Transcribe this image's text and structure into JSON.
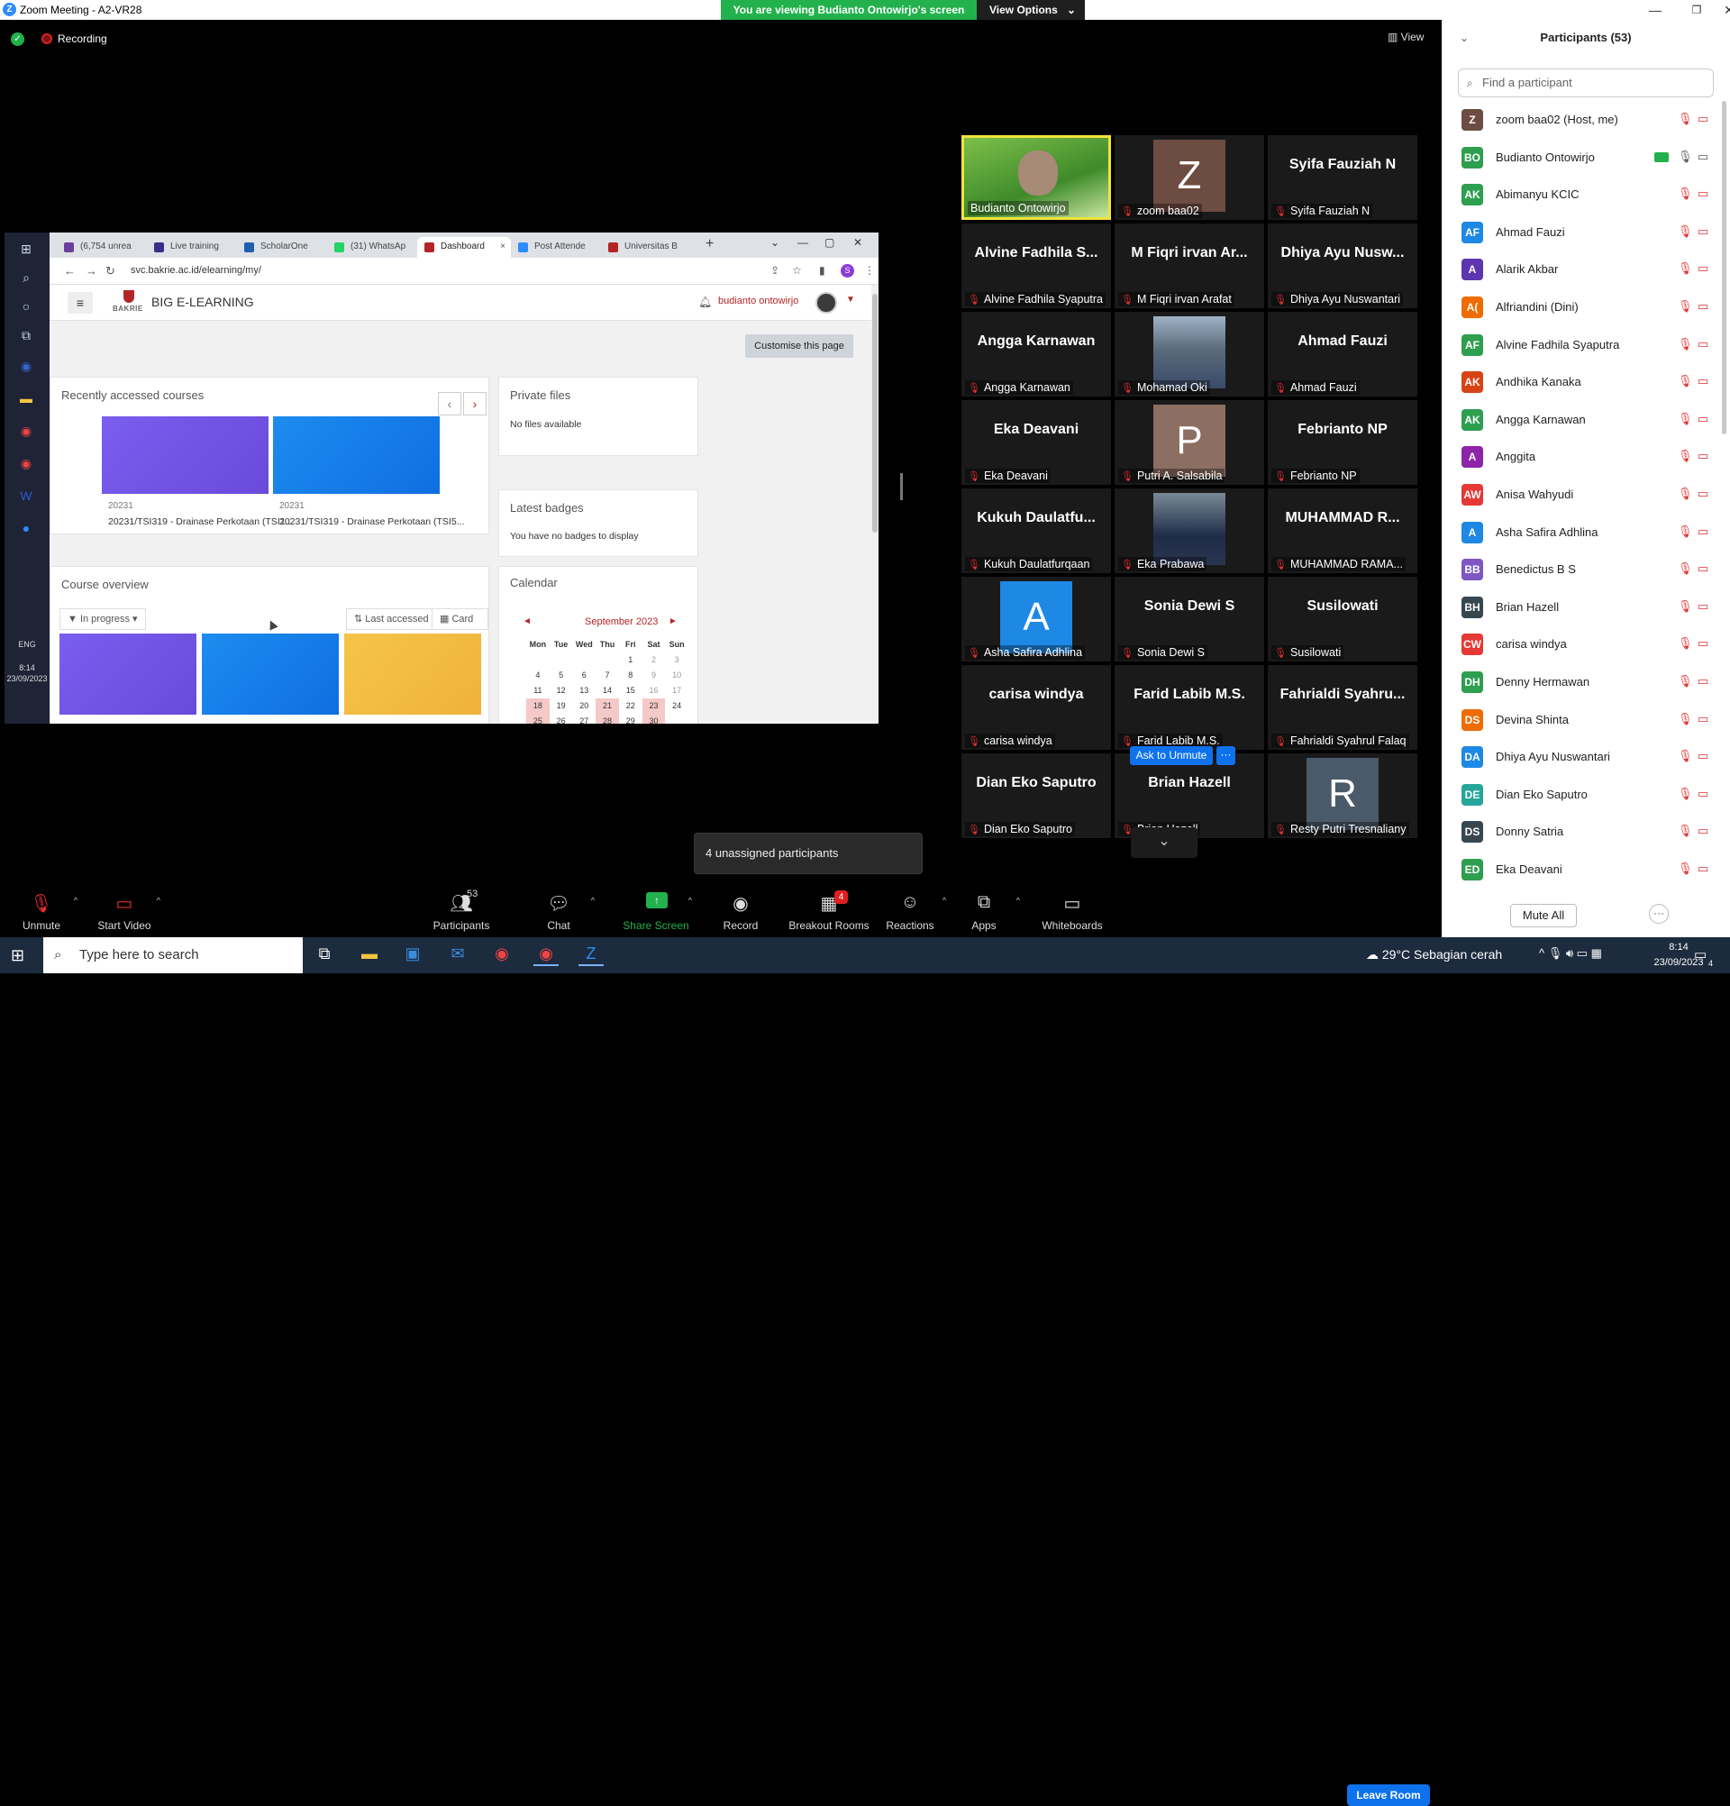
{
  "window": {
    "title": "Zoom Meeting - A2-VR28",
    "viewing_banner": "You are viewing Budianto Ontowirjo's screen",
    "view_options": "View Options",
    "recording": "Recording",
    "view": "View"
  },
  "shared": {
    "tabs": [
      "(6,754 unrea",
      "Live training",
      "ScholarOne",
      "(31) WhatsAp",
      "Dashboard",
      "Post Attende",
      "Universitas B"
    ],
    "url": "svc.bakrie.ac.id/elearning/my/",
    "profile_initial": "S",
    "logo_text": "BAKRIE",
    "site_name": "BIG E-LEARNING",
    "user_name": "budianto ontowirjo",
    "customise": "Customise this page",
    "recent_title": "Recently accessed courses",
    "courses": [
      {
        "year": "20231",
        "name": "20231/TSI319 - Drainase Perkotaan (TSI1..."
      },
      {
        "year": "20231",
        "name": "20231/TSI319 - Drainase Perkotaan (TSI5..."
      }
    ],
    "private_title": "Private files",
    "private_body": "No files available",
    "badges_title": "Latest badges",
    "badges_body": "You have no badges to display",
    "overview_title": "Course overview",
    "filter_label": "In progress",
    "sort_label": "Last accessed",
    "view_label": "Card",
    "calendar_title": "Calendar",
    "calendar_month": "September 2023",
    "calendar_days": [
      "Mon",
      "Tue",
      "Wed",
      "Thu",
      "Fri",
      "Sat",
      "Sun"
    ],
    "calendar_rows": [
      [
        "",
        "",
        "",
        "",
        "1",
        "2",
        "3"
      ],
      [
        "4",
        "5",
        "6",
        "7",
        "8",
        "9",
        "10"
      ],
      [
        "11",
        "12",
        "13",
        "14",
        "15",
        "16",
        "17"
      ],
      [
        "18",
        "19",
        "20",
        "21",
        "22",
        "23",
        "24"
      ],
      [
        "25",
        "26",
        "27",
        "28",
        "29",
        "30",
        ""
      ]
    ],
    "clock_time": "8:14",
    "clock_date": "23/09/2023",
    "lang": "ENG"
  },
  "gallery": {
    "tiles": [
      {
        "big": "",
        "label": "Budianto Ontowirjo",
        "muted": false,
        "type": "photo",
        "active": true
      },
      {
        "big": "Z",
        "label": "zoom baa02",
        "muted": true,
        "type": "avatar",
        "color": "#6d4c41"
      },
      {
        "big": "Syifa Fauziah N",
        "label": "Syifa Fauziah N",
        "muted": true,
        "type": "name"
      },
      {
        "big": "Alvine Fadhila S...",
        "label": "Alvine Fadhila Syaputra",
        "muted": true,
        "type": "name"
      },
      {
        "big": "M Fiqri irvan Ar...",
        "label": "M Fiqri irvan Arafat",
        "muted": true,
        "type": "name"
      },
      {
        "big": "Dhiya Ayu Nusw...",
        "label": "Dhiya Ayu Nuswantari",
        "muted": true,
        "type": "name"
      },
      {
        "big": "Angga Karnawan",
        "label": "Angga Karnawan",
        "muted": true,
        "type": "name"
      },
      {
        "big": "",
        "label": "Mohamad Oki",
        "muted": true,
        "type": "photo2"
      },
      {
        "big": "Ahmad Fauzi",
        "label": "Ahmad Fauzi",
        "muted": true,
        "type": "name"
      },
      {
        "big": "Eka Deavani",
        "label": "Eka Deavani",
        "muted": true,
        "type": "name"
      },
      {
        "big": "P",
        "label": "Putri A. Salsabila",
        "muted": true,
        "type": "avatar",
        "color": "#8d6e63"
      },
      {
        "big": "Febrianto NP",
        "label": "Febrianto NP",
        "muted": true,
        "type": "name"
      },
      {
        "big": "Kukuh  Daulatfu...",
        "label": "Kukuh Daulatfurqaan",
        "muted": true,
        "type": "name"
      },
      {
        "big": "",
        "label": "Eka Prabawa",
        "muted": true,
        "type": "photo3"
      },
      {
        "big": "MUHAMMAD  R...",
        "label": "MUHAMMAD RAMA...",
        "muted": true,
        "type": "name"
      },
      {
        "big": "A",
        "label": "Asha Safira Adhlina",
        "muted": true,
        "type": "avatar",
        "color": "#1e88e5"
      },
      {
        "big": "Sonia Dewi S",
        "label": "Sonia Dewi S",
        "muted": true,
        "type": "name"
      },
      {
        "big": "Susilowati",
        "label": "Susilowati",
        "muted": true,
        "type": "name"
      },
      {
        "big": "carisa windya",
        "label": "carisa windya",
        "muted": true,
        "type": "name"
      },
      {
        "big": "Farid Labib M.S.",
        "label": "Farid Labib M.S.",
        "muted": true,
        "type": "name"
      },
      {
        "big": "Fahrialdi  Syahru...",
        "label": "Fahrialdi Syahrul Falaq",
        "muted": true,
        "type": "name"
      },
      {
        "big": "Dian Eko Saputro",
        "label": "Dian Eko Saputro",
        "muted": true,
        "type": "name"
      },
      {
        "big": "Brian Hazell",
        "label": "Brian Hazell",
        "muted": true,
        "type": "name"
      },
      {
        "big": "R",
        "label": "Resty Putri Tresnaliany",
        "muted": true,
        "type": "avatar",
        "color": "#4a5a6a"
      }
    ],
    "ask_unmute": "Ask to Unmute",
    "more": "···",
    "unassigned": "4 unassigned participants"
  },
  "participants": {
    "header": "Participants (53)",
    "search_placeholder": "Find a participant",
    "rows": [
      {
        "initials": "Z",
        "name": "zoom baa02 (Host, me)",
        "color": "#6d4c41"
      },
      {
        "initials": "BO",
        "name": "Budianto Ontowirjo",
        "color": "#2e9e4f",
        "sharing": true
      },
      {
        "initials": "AK",
        "name": "Abimanyu KCIC",
        "color": "#2e9e4f"
      },
      {
        "initials": "AF",
        "name": "Ahmad Fauzi",
        "color": "#1e88e5"
      },
      {
        "initials": "A",
        "name": "Alarik Akbar",
        "color": "#5e35b1"
      },
      {
        "initials": "A(",
        "name": "Alfriandini (Dini)",
        "color": "#ef6c00"
      },
      {
        "initials": "AF",
        "name": "Alvine Fadhila Syaputra",
        "color": "#2e9e4f"
      },
      {
        "initials": "AK",
        "name": "Andhika Kanaka",
        "color": "#d84315"
      },
      {
        "initials": "AK",
        "name": "Angga Karnawan",
        "color": "#2e9e4f"
      },
      {
        "initials": "A",
        "name": "Anggita",
        "color": "#8e24aa"
      },
      {
        "initials": "AW",
        "name": "Anisa Wahyudi",
        "color": "#e53935"
      },
      {
        "initials": "A",
        "name": "Asha Safira Adhlina",
        "color": "#1e88e5"
      },
      {
        "initials": "BB",
        "name": "Benedictus B S",
        "color": "#7e57c2"
      },
      {
        "initials": "BH",
        "name": "Brian Hazell",
        "color": "#37474f"
      },
      {
        "initials": "CW",
        "name": "carisa windya",
        "color": "#e53935"
      },
      {
        "initials": "DH",
        "name": "Denny Hermawan",
        "color": "#2e9e4f"
      },
      {
        "initials": "DS",
        "name": "Devina Shinta",
        "color": "#ef6c00"
      },
      {
        "initials": "DA",
        "name": "Dhiya Ayu Nuswantari",
        "color": "#1e88e5"
      },
      {
        "initials": "DE",
        "name": "Dian Eko Saputro",
        "color": "#26a69a"
      },
      {
        "initials": "DS",
        "name": "Donny Satria",
        "color": "#37474f"
      },
      {
        "initials": "ED",
        "name": "Eka Deavani",
        "color": "#2e9e4f"
      }
    ],
    "mute_all": "Mute All",
    "more": "···"
  },
  "toolbar": {
    "unmute": "Unmute",
    "start_video": "Start Video",
    "participants": "Participants",
    "participants_count": "53",
    "chat": "Chat",
    "share_screen": "Share Screen",
    "record": "Record",
    "breakout": "Breakout Rooms",
    "breakout_badge": "4",
    "reactions": "Reactions",
    "apps": "Apps",
    "whiteboards": "Whiteboards",
    "leave": "Leave Room"
  },
  "taskbar": {
    "search_placeholder": "Type here to search",
    "weather": "29°C  Sebagian cerah",
    "time": "8:14",
    "date": "23/09/2023",
    "notif_count": "4"
  }
}
